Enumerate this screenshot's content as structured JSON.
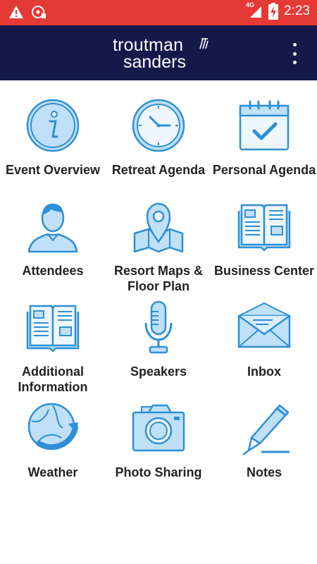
{
  "status_bar": {
    "time": "2:23",
    "network": "4G",
    "icons": [
      "warning-icon",
      "media-icon",
      "signal-icon",
      "battery-charging-icon"
    ]
  },
  "app_bar": {
    "logo_line1": "troutman",
    "logo_line2": "sanders",
    "menu_icon": "more-vert-icon"
  },
  "colors": {
    "status_bar": "#e53935",
    "app_bar": "#14194a",
    "icon_stroke": "#2e8fd6",
    "icon_fill": "#bfe0f7"
  },
  "tiles": [
    {
      "label": "Event Overview",
      "icon": "info-icon"
    },
    {
      "label": "Retreat Agenda",
      "icon": "clock-icon"
    },
    {
      "label": "Personal Agenda",
      "icon": "calendar-check-icon"
    },
    {
      "label": "Attendees",
      "icon": "person-icon"
    },
    {
      "label": "Resort Maps & Floor Plan",
      "icon": "map-pin-icon"
    },
    {
      "label": "Business Center",
      "icon": "book-icon"
    },
    {
      "label": "Additional Information",
      "icon": "open-book-icon"
    },
    {
      "label": "Speakers",
      "icon": "microphone-icon"
    },
    {
      "label": "Inbox",
      "icon": "envelope-icon"
    },
    {
      "label": "Weather",
      "icon": "globe-arrow-icon"
    },
    {
      "label": "Photo Sharing",
      "icon": "camera-icon"
    },
    {
      "label": "Notes",
      "icon": "pen-icon"
    }
  ]
}
